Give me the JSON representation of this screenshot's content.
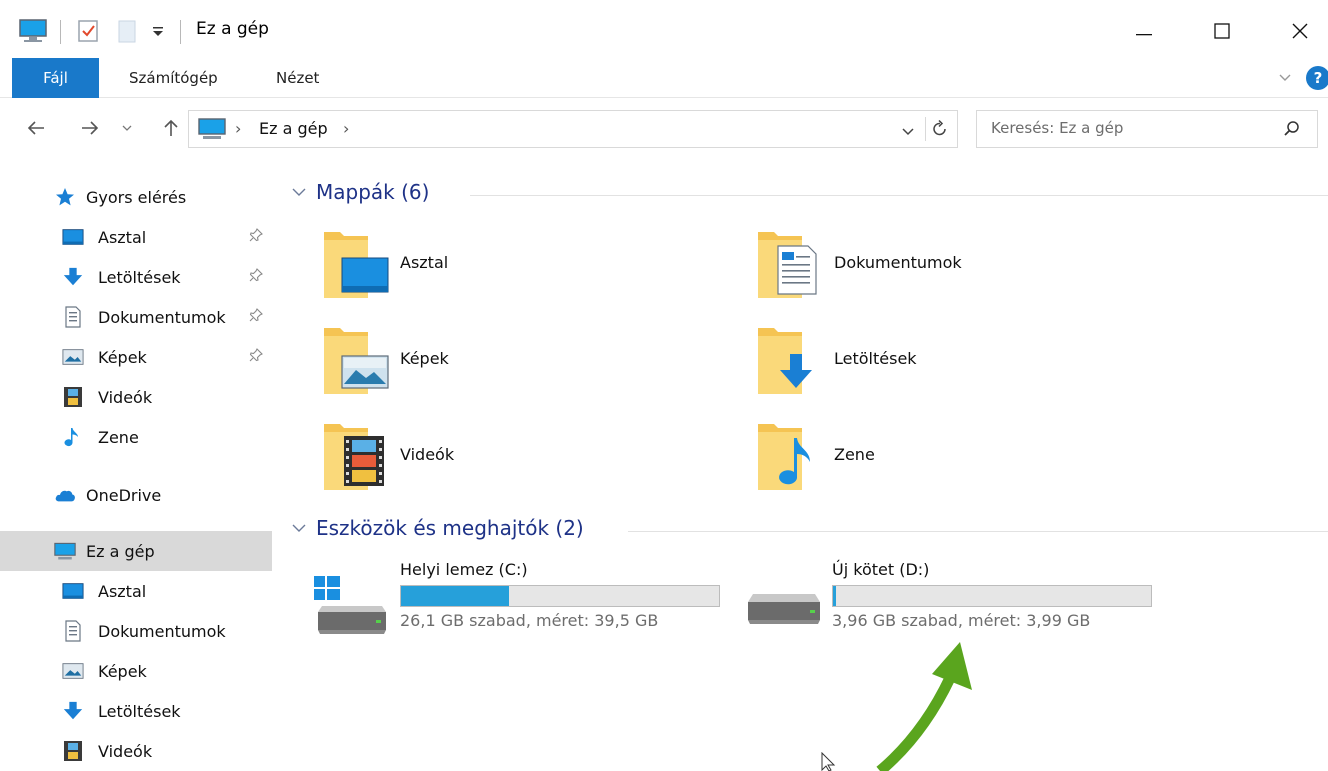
{
  "window": {
    "title": "Ez a gép",
    "minimize_icon": "—",
    "maximize_icon": "☐",
    "close_icon": "✕"
  },
  "ribbon": {
    "tabs": [
      {
        "label": "Fájl",
        "active": true
      },
      {
        "label": "Számítógép"
      },
      {
        "label": "Nézet"
      }
    ],
    "help": "?",
    "accent_color": "#1979ca"
  },
  "address": {
    "path": "Ez a gép",
    "separator_1": "›",
    "separator_2": "›",
    "search_placeholder": "Keresés: Ez a gép"
  },
  "sidebar": {
    "quick_access": "Gyors elérés",
    "quick_items": [
      {
        "label": "Asztal",
        "icon": "desktop-icon",
        "pinned": true
      },
      {
        "label": "Letöltések",
        "icon": "download-icon",
        "pinned": true
      },
      {
        "label": "Dokumentumok",
        "icon": "document-icon",
        "pinned": true
      },
      {
        "label": "Képek",
        "icon": "pictures-icon",
        "pinned": true
      },
      {
        "label": "Videók",
        "icon": "video-icon",
        "pinned": false
      },
      {
        "label": "Zene",
        "icon": "music-icon",
        "pinned": false
      }
    ],
    "onedrive": "OneDrive",
    "this_pc": "Ez a gép",
    "pc_items": [
      {
        "label": "Asztal",
        "icon": "desktop-icon"
      },
      {
        "label": "Dokumentumok",
        "icon": "document-icon"
      },
      {
        "label": "Képek",
        "icon": "pictures-icon"
      },
      {
        "label": "Letöltések",
        "icon": "download-icon"
      },
      {
        "label": "Videók",
        "icon": "video-icon"
      }
    ]
  },
  "content": {
    "folders_header": "Mappák (6)",
    "folders": [
      {
        "label": "Asztal",
        "icon": "desktop-folder-icon"
      },
      {
        "label": "Dokumentumok",
        "icon": "documents-folder-icon"
      },
      {
        "label": "Képek",
        "icon": "pictures-folder-icon"
      },
      {
        "label": "Letöltések",
        "icon": "downloads-folder-icon"
      },
      {
        "label": "Videók",
        "icon": "videos-folder-icon"
      },
      {
        "label": "Zene",
        "icon": "music-folder-icon"
      }
    ],
    "drives_header": "Eszközök és meghajtók (2)",
    "drives": [
      {
        "name": "Helyi lemez (C:)",
        "info": "26,1 GB szabad, méret: 39,5 GB",
        "free_gb": 26.1,
        "total_gb": 39.5,
        "icon": "windows-drive-icon"
      },
      {
        "name": "Új kötet (D:)",
        "info": "3,96 GB szabad, méret: 3,99 GB",
        "free_gb": 3.96,
        "total_gb": 3.99,
        "icon": "drive-icon"
      }
    ]
  },
  "colors": {
    "selection": "#d9d9d9",
    "header_text": "#1e3287",
    "drive_bar_fill": "#26a0da",
    "annotation_arrow": "#5aa51e"
  }
}
